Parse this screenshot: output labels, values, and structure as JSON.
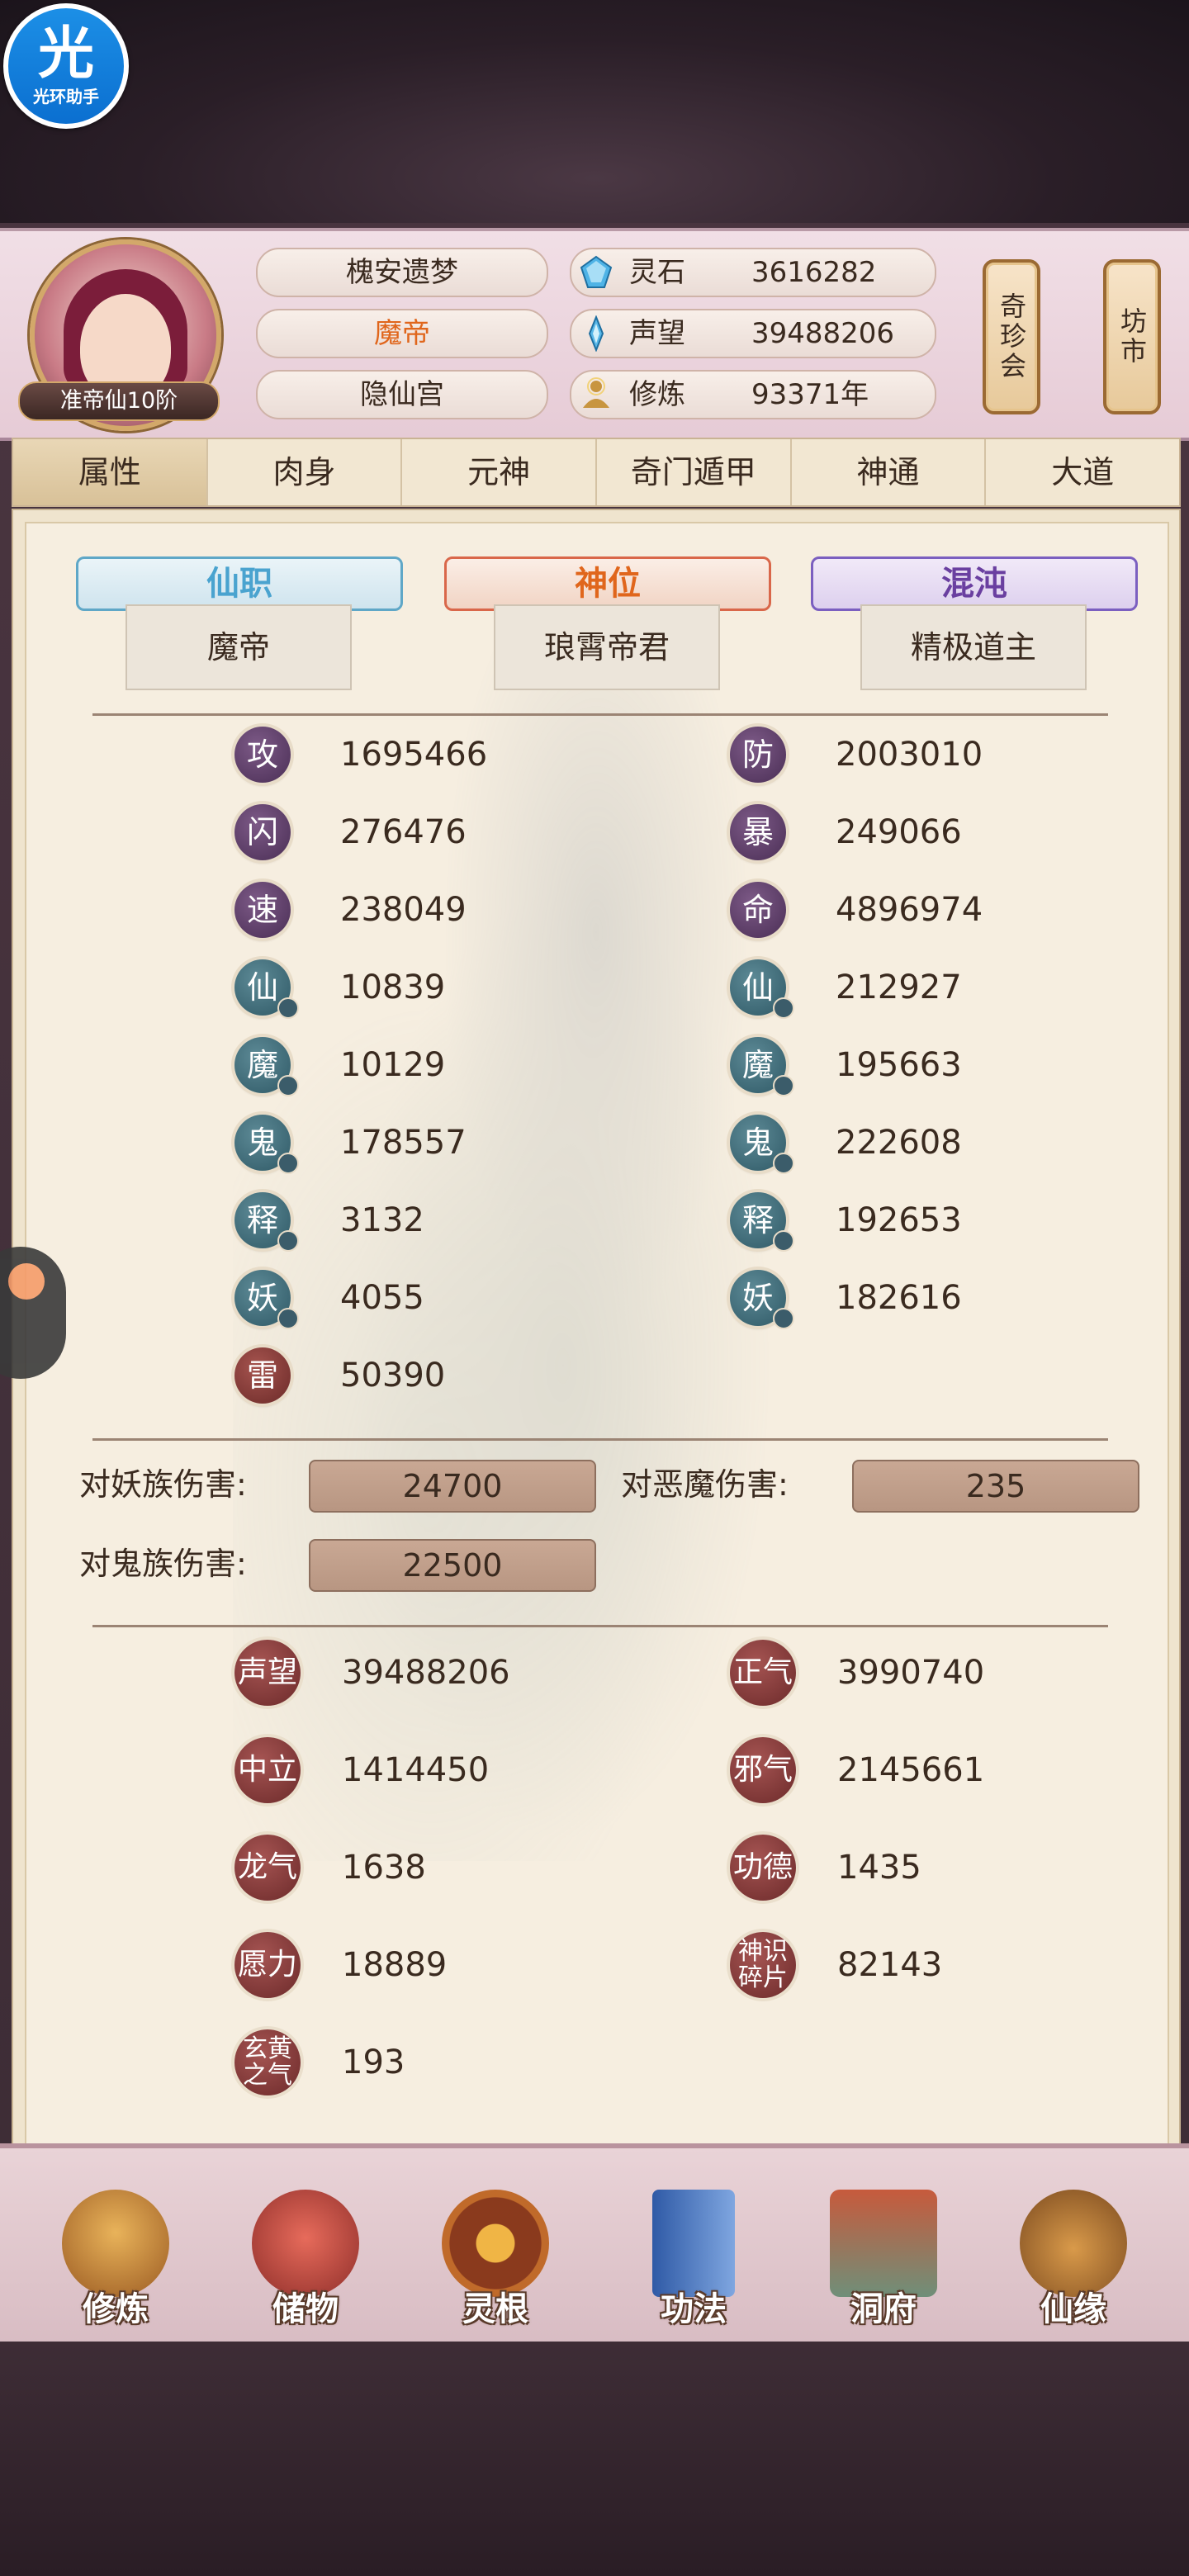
{
  "overlay": {
    "logo_big": "光",
    "logo_small": "光环助手"
  },
  "header": {
    "rank": "准帝仙10阶",
    "names": [
      "槐安遗梦",
      "魔帝",
      "隐仙宫"
    ],
    "resources": [
      {
        "icon": "spirit-stone-icon",
        "label": "灵石",
        "value": "3616282"
      },
      {
        "icon": "prestige-icon",
        "label": "声望",
        "value": "39488206"
      },
      {
        "icon": "cultivate-icon",
        "label": "修炼",
        "value": "93371年"
      }
    ],
    "side_buttons": [
      "奇珍会",
      "坊市"
    ]
  },
  "tabs": [
    "属性",
    "肉身",
    "元神",
    "奇门遁甲",
    "神通",
    "大道"
  ],
  "ranks": [
    {
      "title": "仙职",
      "value": "魔帝",
      "color": "#4aa3cf"
    },
    {
      "title": "神位",
      "value": "琅霄帝君",
      "color": "#e0661c"
    },
    {
      "title": "混沌",
      "value": "精极道主",
      "color": "#6a3fa0"
    }
  ],
  "stats_left": [
    {
      "icon": "攻",
      "value": "1695466",
      "style": "purple"
    },
    {
      "icon": "闪",
      "value": "276476",
      "style": "purple"
    },
    {
      "icon": "速",
      "value": "238049",
      "style": "purple"
    },
    {
      "icon": "仙",
      "value": "10839",
      "style": "teal"
    },
    {
      "icon": "魔",
      "value": "10129",
      "style": "teal"
    },
    {
      "icon": "鬼",
      "value": "178557",
      "style": "teal"
    },
    {
      "icon": "释",
      "value": "3132",
      "style": "teal"
    },
    {
      "icon": "妖",
      "value": "4055",
      "style": "teal"
    },
    {
      "icon": "雷",
      "value": "50390",
      "style": "red"
    }
  ],
  "stats_right": [
    {
      "icon": "防",
      "value": "2003010",
      "style": "purple"
    },
    {
      "icon": "暴",
      "value": "249066",
      "style": "purple"
    },
    {
      "icon": "命",
      "value": "4896974",
      "style": "purple"
    },
    {
      "icon": "仙",
      "value": "212927",
      "style": "teal"
    },
    {
      "icon": "魔",
      "value": "195663",
      "style": "teal"
    },
    {
      "icon": "鬼",
      "value": "222608",
      "style": "teal"
    },
    {
      "icon": "释",
      "value": "192653",
      "style": "teal"
    },
    {
      "icon": "妖",
      "value": "182616",
      "style": "teal"
    }
  ],
  "damage": [
    {
      "label": "对妖族伤害:",
      "value": "24700"
    },
    {
      "label": "对恶魔伤害:",
      "value": "235"
    },
    {
      "label": "对鬼族伤害:",
      "value": "22500"
    }
  ],
  "attributes_left": [
    {
      "icon": "声望",
      "value": "39488206"
    },
    {
      "icon": "中立",
      "value": "1414450"
    },
    {
      "icon": "龙气",
      "value": "1638"
    },
    {
      "icon": "愿力",
      "value": "18889"
    },
    {
      "icon": "玄黄之气",
      "value": "193"
    }
  ],
  "attributes_right": [
    {
      "icon": "正气",
      "value": "3990740"
    },
    {
      "icon": "邪气",
      "value": "2145661"
    },
    {
      "icon": "功德",
      "value": "1435"
    },
    {
      "icon": "神识碎片",
      "value": "82143"
    }
  ],
  "bottom_nav": [
    "修炼",
    "储物",
    "灵根",
    "功法",
    "洞府",
    "仙缘"
  ]
}
